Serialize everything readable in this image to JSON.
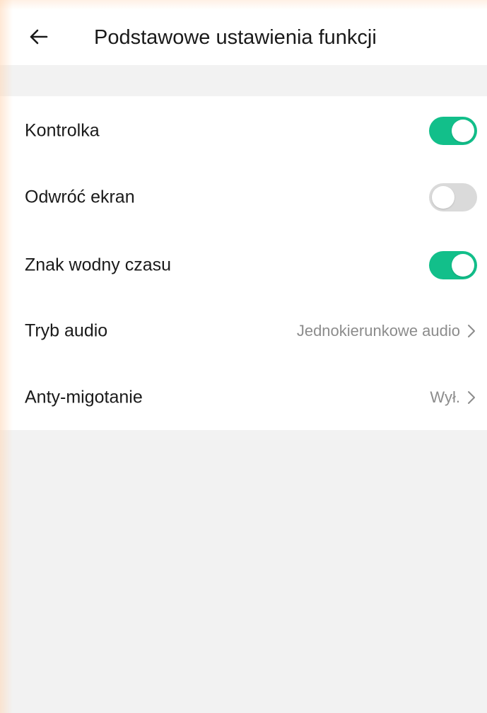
{
  "header": {
    "title": "Podstawowe ustawienia funkcji",
    "back_icon": "arrow-left-icon"
  },
  "settings": [
    {
      "label": "Kontrolka",
      "type": "toggle",
      "on": true
    },
    {
      "label": "Odwróć ekran",
      "type": "toggle",
      "on": false
    },
    {
      "label": "Znak wodny czasu",
      "type": "toggle",
      "on": true
    },
    {
      "label": "Tryb audio",
      "type": "nav",
      "value": "Jednokierunkowe audio",
      "icon": "chevron-right-icon"
    },
    {
      "label": "Anty-migotanie",
      "type": "nav",
      "value": "Wył.",
      "icon": "chevron-right-icon"
    }
  ],
  "colors": {
    "toggle_on": "#12bf8a",
    "toggle_off": "#dadada",
    "background": "#f2f2f2"
  }
}
